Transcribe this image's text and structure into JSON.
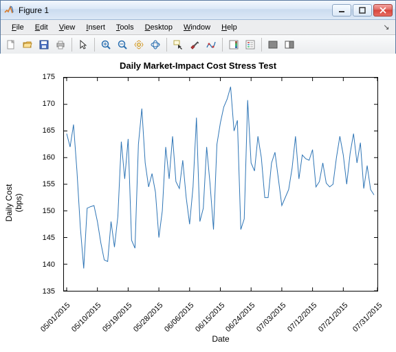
{
  "window": {
    "title": "Figure 1",
    "minimize_tip": "Minimize",
    "maximize_tip": "Maximize",
    "close_tip": "Close"
  },
  "menu": {
    "file": "File",
    "edit": "Edit",
    "view": "View",
    "insert": "Insert",
    "tools": "Tools",
    "desktop": "Desktop",
    "window": "Window",
    "help": "Help"
  },
  "chart_data": {
    "type": "line",
    "title": "Daily Market-Impact Cost Stress Test",
    "xlabel": "Date",
    "ylabel": "Daily Cost\n(bps)",
    "ylim": [
      135,
      175
    ],
    "yticks": [
      135,
      140,
      145,
      150,
      155,
      160,
      165,
      170,
      175
    ],
    "xticks": [
      "05/01/2015",
      "05/10/2015",
      "05/19/2015",
      "05/28/2015",
      "06/06/2015",
      "06/15/2015",
      "06/24/2015",
      "07/03/2015",
      "07/12/2015",
      "07/21/2015",
      "07/31/2015"
    ],
    "categories": [
      0,
      1,
      2,
      3,
      4,
      5,
      6,
      7,
      8,
      9,
      10,
      11,
      12,
      13,
      14,
      15,
      16,
      17,
      18,
      19,
      20,
      21,
      22,
      23,
      24,
      25,
      26,
      27,
      28,
      29,
      30,
      31,
      32,
      33,
      34,
      35,
      36,
      37,
      38,
      39,
      40,
      41,
      42,
      43,
      44,
      45,
      46,
      47,
      48,
      49,
      50,
      51,
      52,
      53,
      54,
      55,
      56,
      57,
      58,
      59,
      60,
      61,
      62,
      63,
      64,
      65,
      66,
      67,
      68,
      69,
      70,
      71,
      72,
      73,
      74,
      75,
      76,
      77,
      78,
      79,
      80,
      81,
      82,
      83,
      84,
      85,
      86,
      87,
      88,
      89,
      90
    ],
    "values": [
      164.5,
      162.0,
      166.2,
      157.5,
      147.0,
      139.2,
      150.5,
      150.8,
      151.0,
      148.0,
      144.0,
      140.8,
      140.5,
      148.0,
      143.2,
      149.0,
      163.0,
      156.0,
      163.5,
      144.5,
      143.0,
      162.5,
      169.2,
      159.0,
      154.5,
      157.0,
      153.5,
      145.0,
      150.0,
      162.0,
      156.0,
      164.0,
      155.5,
      154.2,
      159.5,
      152.5,
      147.5,
      154.5,
      167.5,
      148.0,
      150.5,
      162.0,
      155.0,
      146.5,
      162.5,
      166.5,
      169.5,
      171.0,
      173.3,
      165.0,
      167.0,
      146.5,
      148.5,
      170.8,
      159.0,
      157.5,
      164.0,
      160.0,
      152.5,
      152.5,
      159.0,
      161.0,
      156.0,
      151.0,
      152.5,
      154.0,
      158.0,
      164.0,
      156.0,
      160.5,
      159.8,
      159.5,
      161.5,
      154.5,
      155.5,
      159.0,
      155.2,
      154.5,
      155.0,
      160.0,
      164.0,
      160.5,
      155.0,
      160.8,
      164.5,
      159.0,
      162.8,
      154.2,
      158.5,
      154.0,
      153.0
    ],
    "x_range": [
      -0.8,
      91
    ]
  }
}
